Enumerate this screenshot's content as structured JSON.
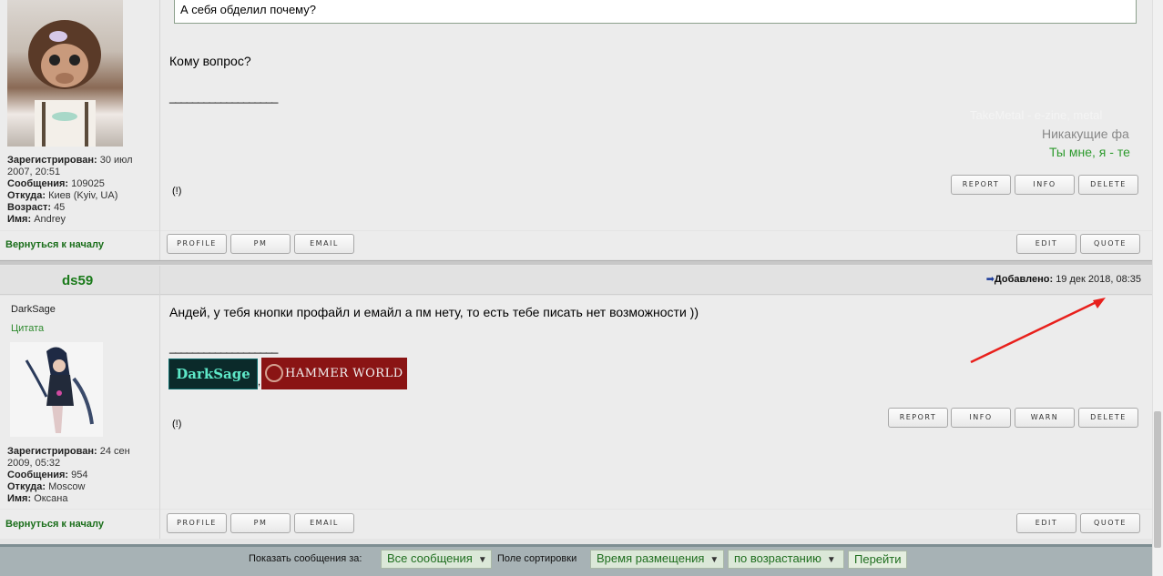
{
  "post1": {
    "quote_text": "А себя обделил почему?",
    "body_text": "Кому вопрос?",
    "sig_line": "___________________",
    "sig_fade_1": "TakeMetal - e-zine, metal",
    "sig_fade_2": "Никакущие фа",
    "sig_fade_3": "Ты мне, я - те",
    "excl": "(!)",
    "user": {
      "reg_label": "Зарегистрирован:",
      "reg_value": "30 июл 2007, 20:51",
      "posts_label": "Сообщения:",
      "posts_value": "109025",
      "from_label": "Откуда:",
      "from_value": "Киев (Kyiv, UA)",
      "age_label": "Возраст:",
      "age_value": "45",
      "name_label": "Имя:",
      "name_value": "Andrey"
    },
    "back": "Вернуться к началу"
  },
  "post2": {
    "username": "ds59",
    "rank": "DarkSage",
    "quote_link": "Цитата",
    "added_label": "Добавлено:",
    "added_value": "19 дек 2018, 08:35",
    "body_text": "Андей, у тебя кнопки профайл и емайл а пм нету, то есть тебе писать нет возможности ))",
    "sig_line": "___________________",
    "banner_1": "DarkSage",
    "banner_2": "HAMMER WORLD",
    "banner_sep": ",",
    "excl": "(!)",
    "user": {
      "reg_label": "Зарегистрирован:",
      "reg_value": "24 сен 2009, 05:32",
      "posts_label": "Сообщения:",
      "posts_value": "954",
      "from_label": "Откуда:",
      "from_value": "Moscow",
      "name_label": "Имя:",
      "name_value": "Оксана"
    },
    "back": "Вернуться к началу"
  },
  "buttons": {
    "report": "REPORT",
    "info": "INFO",
    "warn": "WARN",
    "delete": "DELETE",
    "profile": "PROFILE",
    "pm": "PM",
    "email": "EMAIL",
    "edit": "EDIT",
    "quote": "QUOTE"
  },
  "bottom": {
    "show_label": "Показать сообщения за:",
    "show_value": "Все сообщения",
    "sort_label": "Поле сортировки",
    "sort_value": "Время размещения",
    "order_value": "по возрастанию",
    "go": "Перейти"
  },
  "colors": {
    "username": "#1a7a1a",
    "link_green": "#1a6e1a",
    "arrow_red": "#e8201c"
  }
}
